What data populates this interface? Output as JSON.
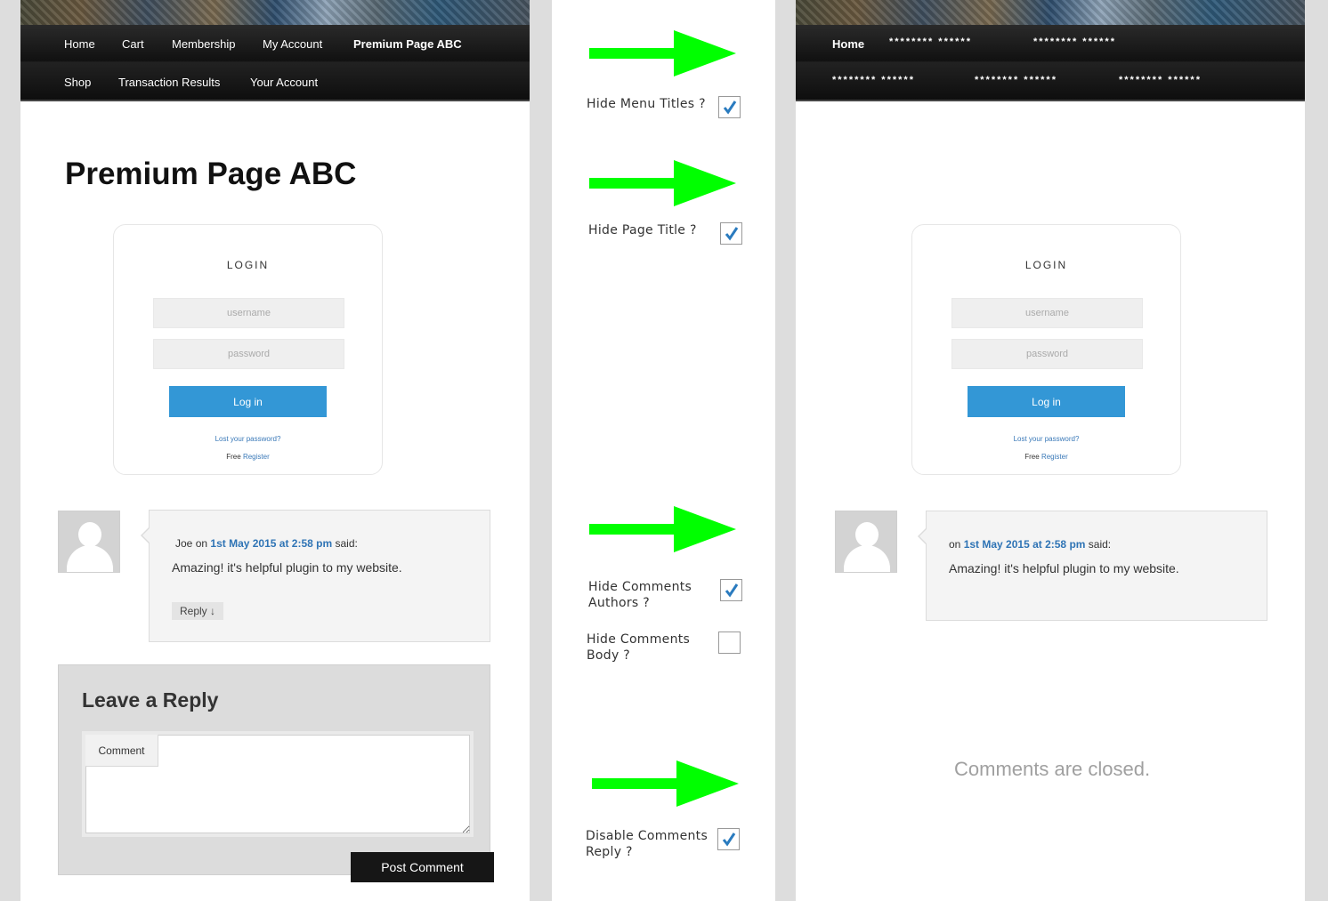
{
  "left_page": {
    "nav_row1": [
      "Home",
      "Cart",
      "Membership",
      "My Account",
      "Premium Page ABC"
    ],
    "nav_row2": [
      "Shop",
      "Transaction Results",
      "Your Account"
    ],
    "page_title": "Premium Page ABC",
    "login": {
      "title": "LOGIN",
      "username_placeholder": "username",
      "password_placeholder": "password",
      "login_button": "Log in",
      "lost_password": "Lost your password?",
      "free": "Free",
      "register": "Register"
    },
    "comment": {
      "author": "Joe",
      "on": "on",
      "date": "1st May 2015 at 2:58 pm",
      "said": "said:",
      "text": "Amazing! it's helpful plugin to my website.",
      "reply": "Reply ↓"
    },
    "reply_form": {
      "title": "Leave a Reply",
      "comment_label": "Comment",
      "post_button": "Post Comment"
    }
  },
  "options": {
    "hide_menu_titles": {
      "label": "Hide Menu Titles ?",
      "checked": true
    },
    "hide_page_title": {
      "label": "Hide Page Title ?",
      "checked": true
    },
    "hide_comments_authors": {
      "label_line1": "Hide Comments",
      "label_line2": "Authors ?",
      "checked": true
    },
    "hide_comments_body": {
      "label_line1": "Hide Comments",
      "label_line2": "Body ?",
      "checked": false
    },
    "disable_comments_reply": {
      "label_line1": "Disable Comments",
      "label_line2": "Reply ?",
      "checked": true
    }
  },
  "right_page": {
    "nav_home": "Home",
    "masked_row1": [
      "******** ******",
      "******** ******"
    ],
    "masked_row2": [
      "******** ******",
      "******** ******",
      "******** ******"
    ],
    "login": {
      "title": "LOGIN",
      "username_placeholder": "username",
      "password_placeholder": "password",
      "login_button": "Log in",
      "lost_password": "Lost your password?",
      "free": "Free",
      "register": "Register"
    },
    "comment": {
      "on": "on",
      "date": "1st May 2015 at 2:58 pm",
      "said": "said:",
      "text": "Amazing! it's helpful plugin to my website."
    },
    "closed_text": "Comments are closed."
  },
  "colors": {
    "arrow": "#00ff00",
    "link": "#2f74b5",
    "login_button": "#3397d6",
    "check": "#2a7bbf"
  }
}
